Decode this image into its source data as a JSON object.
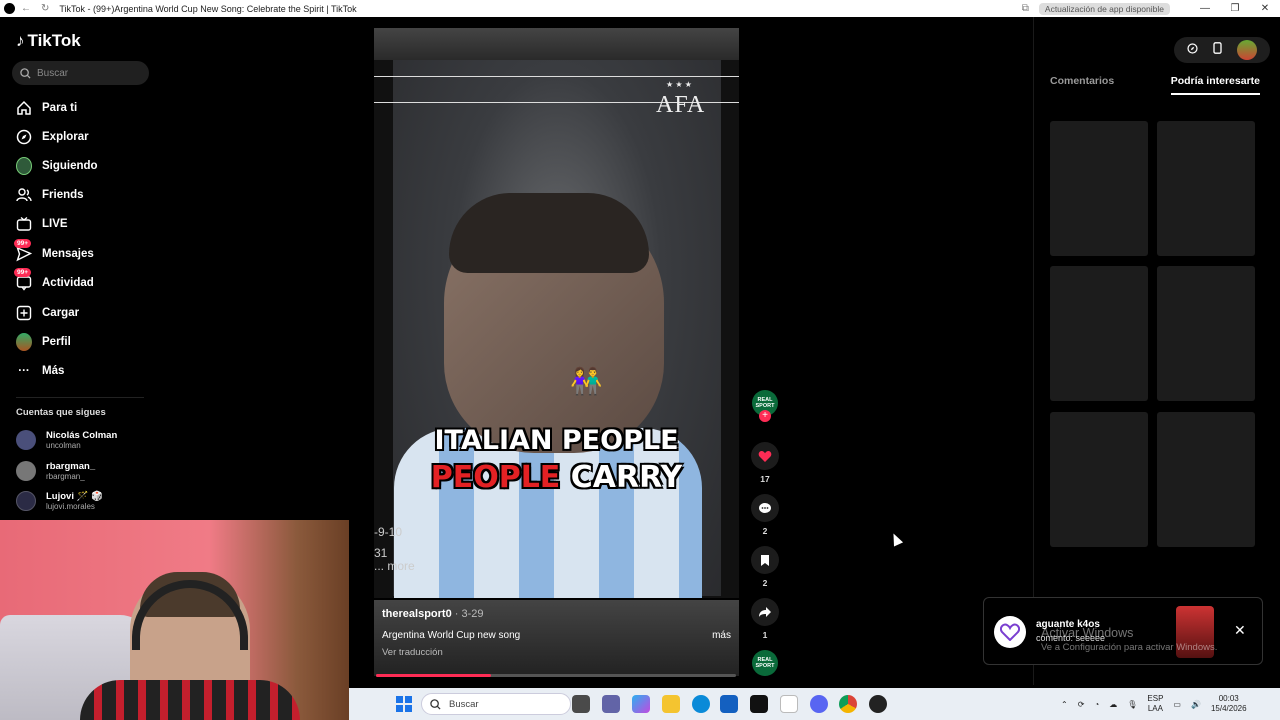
{
  "window": {
    "title": "TikTok - (99+)Argentina World Cup New Song: Celebrate the Spirit | TikTok",
    "update_label": "Actualización de app disponible"
  },
  "sidebar": {
    "logo": "TikTok",
    "search_placeholder": "Buscar",
    "items": [
      {
        "label": "Para ti",
        "icon": "home-icon"
      },
      {
        "label": "Explorar",
        "icon": "compass-icon"
      },
      {
        "label": "Siguiendo",
        "icon": "following-avatar-icon"
      },
      {
        "label": "Friends",
        "icon": "friends-icon"
      },
      {
        "label": "LIVE",
        "icon": "live-tv-icon"
      },
      {
        "label": "Mensajes",
        "icon": "message-icon",
        "badge": "99+"
      },
      {
        "label": "Actividad",
        "icon": "activity-icon",
        "badge": "99+"
      },
      {
        "label": "Cargar",
        "icon": "upload-icon"
      },
      {
        "label": "Perfil",
        "icon": "profile-avatar-icon"
      },
      {
        "label": "Más",
        "icon": "more-icon"
      }
    ],
    "following_heading": "Cuentas que sigues",
    "accounts": [
      {
        "name": "Nicolás Colman",
        "handle": "uncolman"
      },
      {
        "name": "rbargman_",
        "handle": "rbargman_"
      },
      {
        "name": "Lujovi 🪄 🎲",
        "handle": "lujovi.morales"
      }
    ]
  },
  "video": {
    "logo_text": "AFA",
    "logo_stars": "★ ★ ★",
    "caption_line1": "ITALIAN PEOPLE",
    "caption_line2_red": "PEOPLE",
    "caption_line2_white": " CARRY",
    "emoji": "👫",
    "overlay_score": "-9-10",
    "overlay_num": "31",
    "overlay_more": "... more",
    "author": "therealsport0",
    "date": " · 3-29",
    "description": "Argentina World Cup new song",
    "more_label": "más",
    "translate_label": "Ver traducción",
    "progress": 0.32
  },
  "actions": {
    "avatar_text": "REAL SPORT",
    "likes": "17",
    "comments": "2",
    "saves": "2",
    "shares": "1"
  },
  "right_panel": {
    "tab_comments": "Comentarios",
    "tab_suggest": "Podría interesarte"
  },
  "notification": {
    "title": "aguante k4os",
    "body": "comento: seeeee"
  },
  "watermark": {
    "line1": "Activar Windows",
    "line2": "Ve a Configuración para activar Windows."
  },
  "taskbar": {
    "search": "Buscar",
    "lang1": "ESP",
    "lang2": "LAA",
    "time": "00:03",
    "date": "15/4/2026"
  },
  "colors": {
    "accent": "#fe2c55",
    "background": "#000000",
    "taskbar": "#e9eef4"
  }
}
